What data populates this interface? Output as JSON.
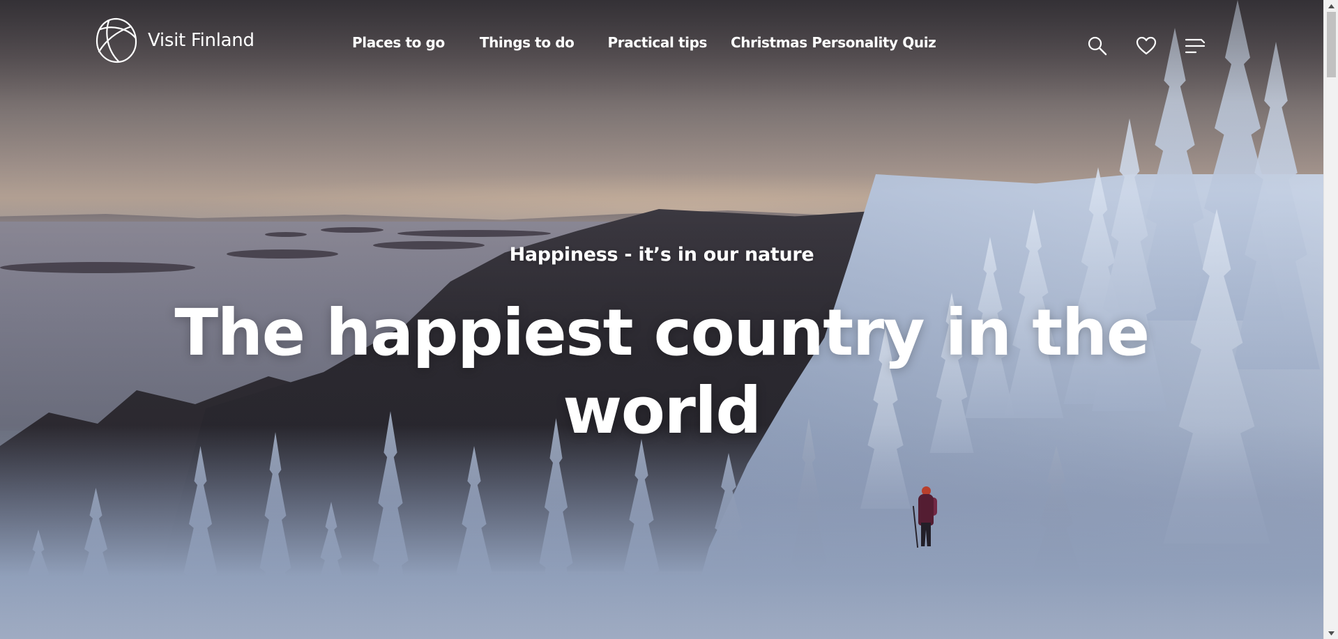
{
  "site": {
    "logo_text": "Visit Finland"
  },
  "nav": {
    "items": [
      {
        "label": "Places to go"
      },
      {
        "label": "Things to do"
      },
      {
        "label": "Practical tips"
      },
      {
        "label": "Christmas Personality Quiz"
      }
    ]
  },
  "header_icons": {
    "search": "search-icon",
    "favorites": "heart-icon",
    "menu": "menu-icon"
  },
  "hero": {
    "tagline": "Happiness - it’s in our nature",
    "title": "The happiest country in the world",
    "text_color": "#ffffff"
  },
  "scrollbar": {
    "up_icon": "scroll-up-arrow-icon",
    "down_icon": "scroll-down-arrow-icon"
  }
}
